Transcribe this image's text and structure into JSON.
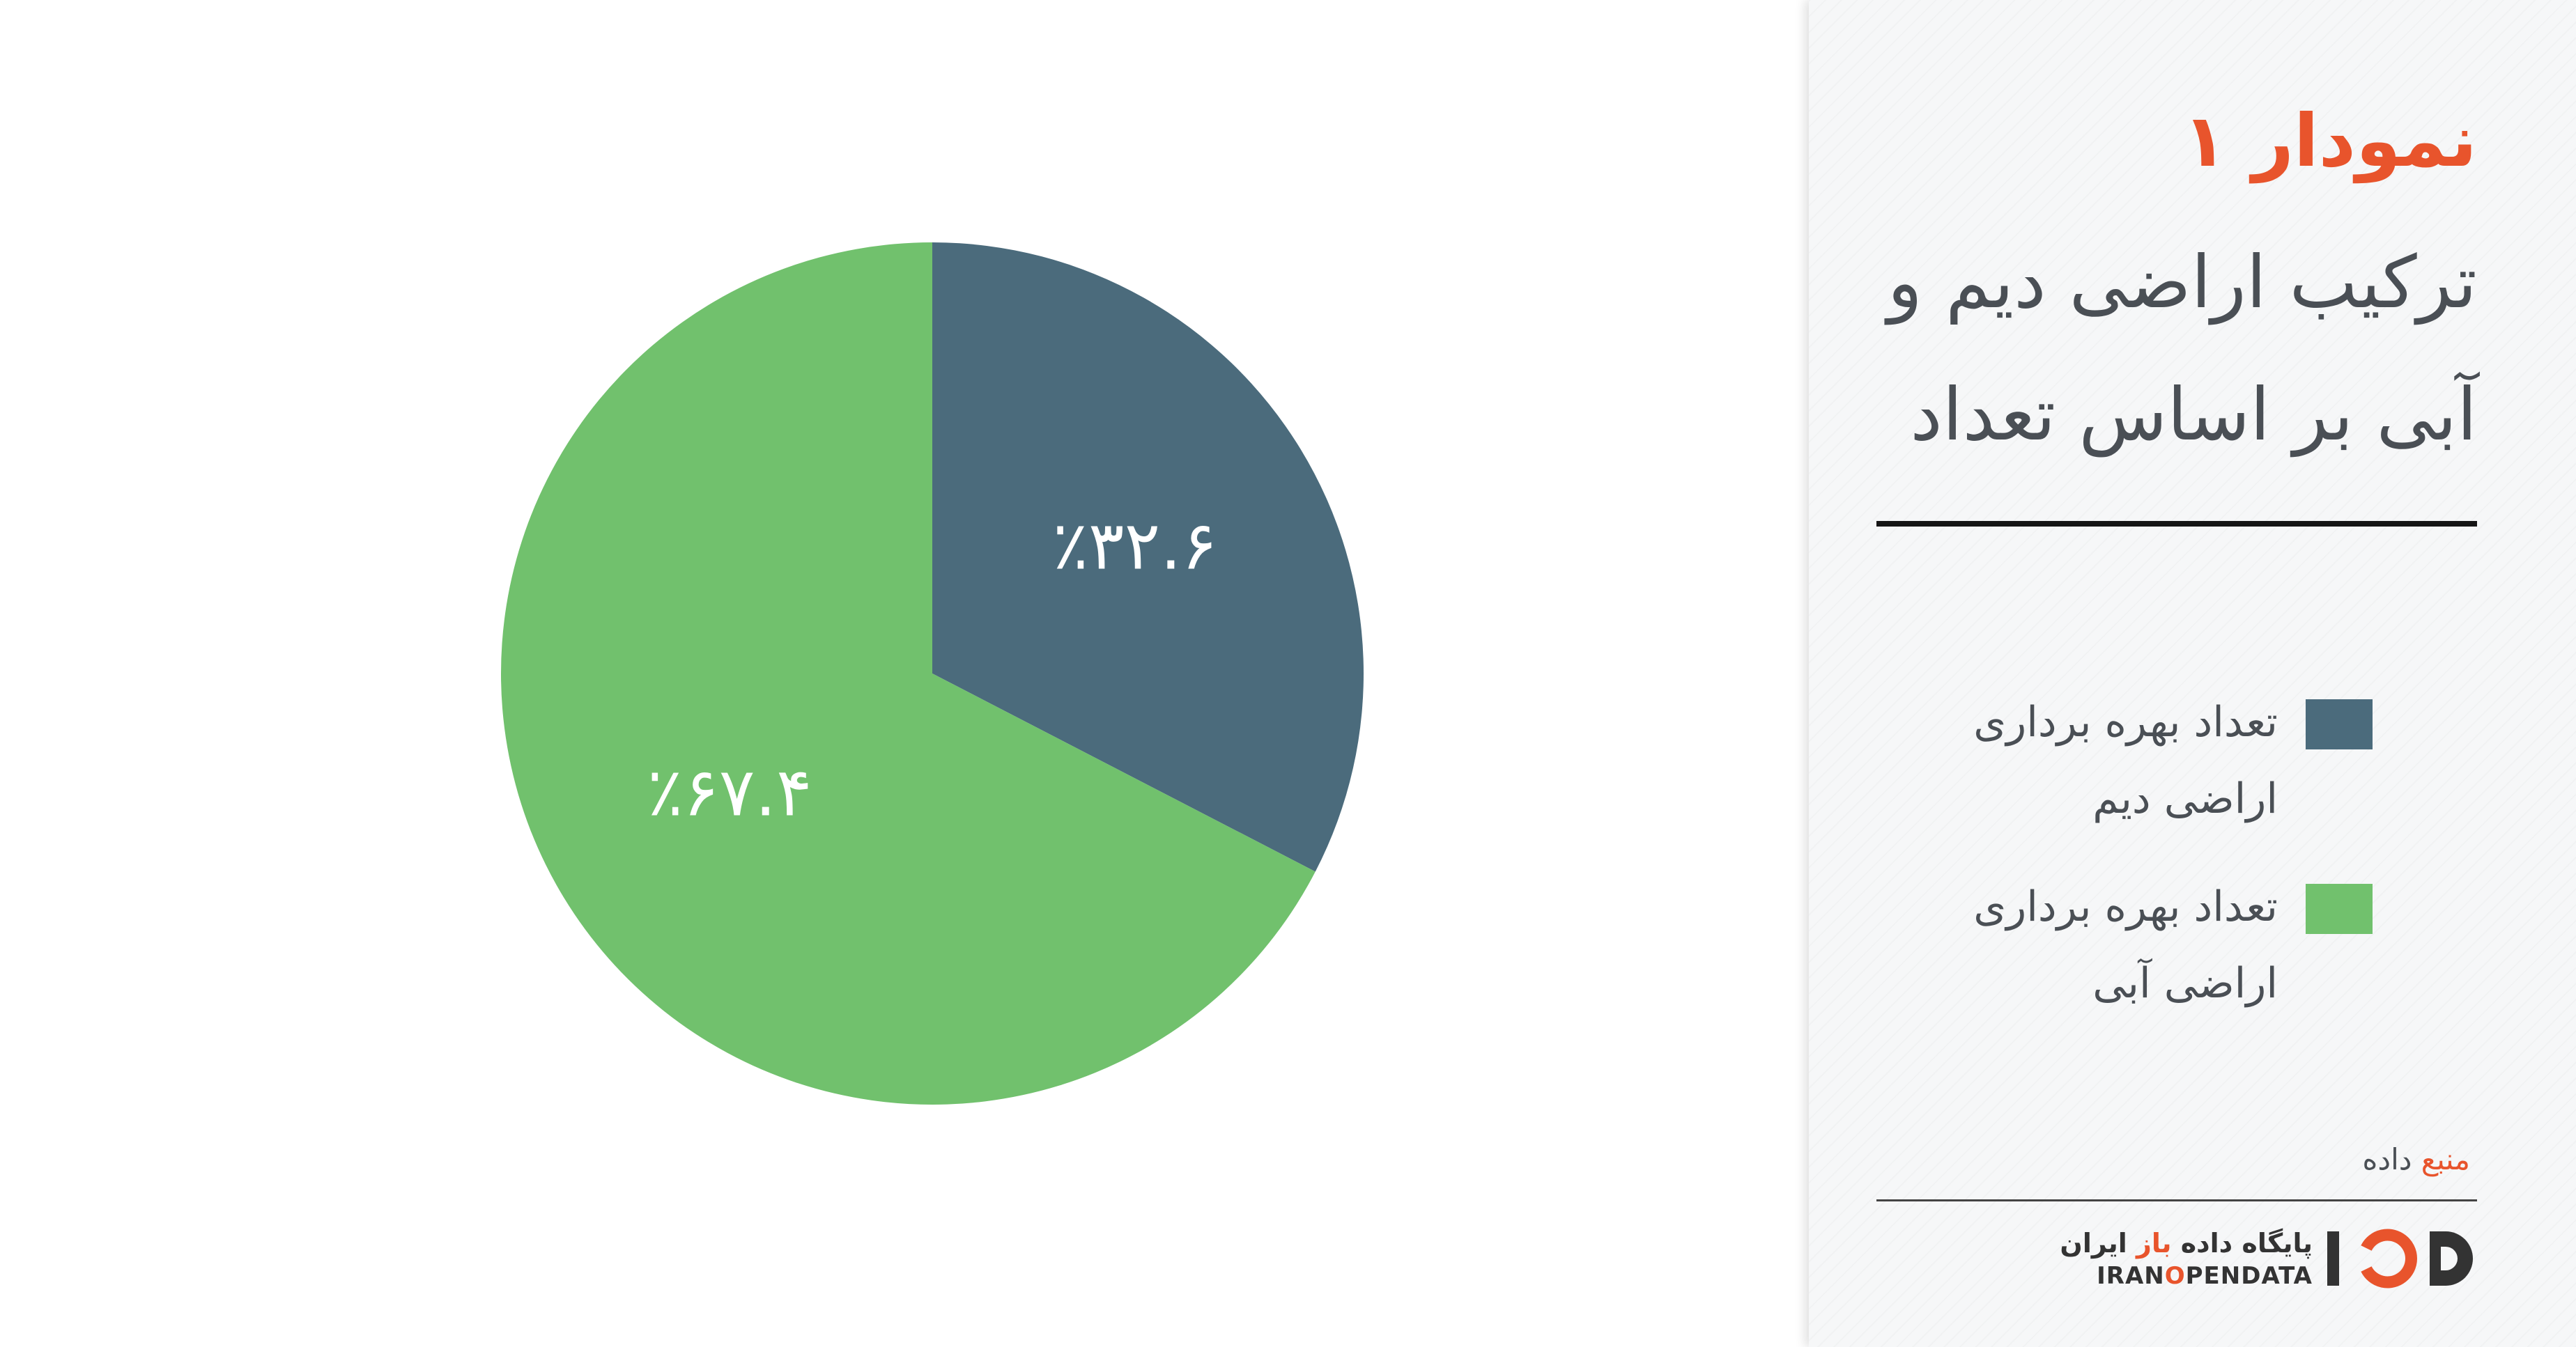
{
  "chart_data": {
    "type": "pie",
    "title": "نمودار ۱",
    "subtitle": "ترکیب اراضی دیم و آبی بر اساس تعداد",
    "legend_position": "right",
    "series": [
      {
        "name": "تعداد بهره برداری اراضی دیم",
        "value": 32.6,
        "label": "٪۳۲.۶",
        "color": "#4b6b7c"
      },
      {
        "name": "تعداد بهره برداری اراضی آبی",
        "value": 67.4,
        "label": "٪۶۷.۴",
        "color": "#71c16d"
      }
    ]
  },
  "panel": {
    "source_prefix": "منبع",
    "source_suffix": " داده",
    "logo_fa_1": "پایگاه داده ",
    "logo_fa_accent": "باز",
    "logo_fa_2": " ایران",
    "logo_en_1": "IRAN",
    "logo_en_accent": "O",
    "logo_en_2": "PENDATA"
  },
  "colors": {
    "accent": "#e8542c",
    "text": "#4a4f55",
    "panel_background": "#f6f7f8"
  }
}
